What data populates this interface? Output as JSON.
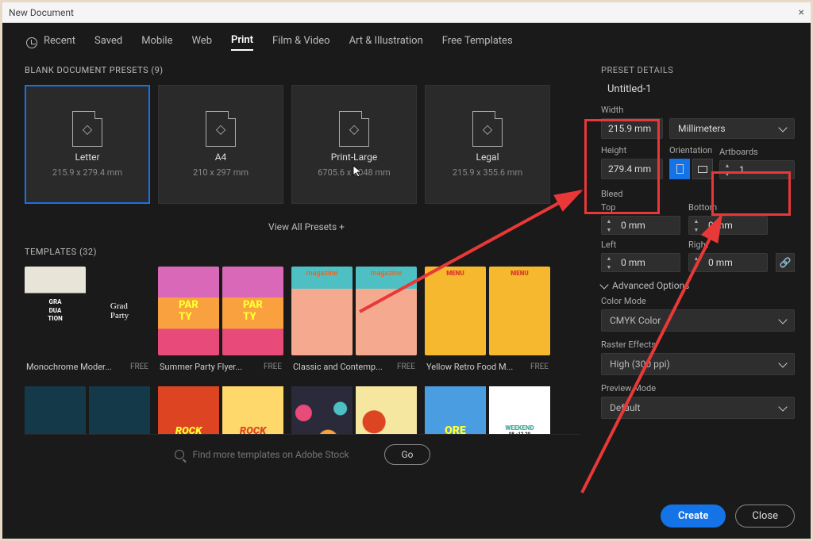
{
  "window": {
    "title": "New Document"
  },
  "tabs": {
    "recent": "Recent",
    "saved": "Saved",
    "mobile": "Mobile",
    "web": "Web",
    "print": "Print",
    "film": "Film & Video",
    "art": "Art & Illustration",
    "free": "Free Templates"
  },
  "presets": {
    "header": "BLANK DOCUMENT PRESETS  (9)",
    "items": [
      {
        "name": "Letter",
        "dim": "215.9 x 279.4 mm"
      },
      {
        "name": "A4",
        "dim": "210 x 297 mm"
      },
      {
        "name": "Print-Large",
        "dim": "6705.6 x 3048 mm"
      },
      {
        "name": "Legal",
        "dim": "215.9 x 355.6 mm"
      }
    ],
    "view_all": "View All Presets +"
  },
  "templates": {
    "header": "TEMPLATES  (32)",
    "items": [
      {
        "name": "Monochrome Moder...",
        "tag": "FREE"
      },
      {
        "name": "Summer Party Flyer...",
        "tag": "FREE"
      },
      {
        "name": "Classic and Contemp...",
        "tag": "FREE"
      },
      {
        "name": "Yellow Retro Food M...",
        "tag": "FREE"
      }
    ]
  },
  "search": {
    "placeholder": "Find more templates on Adobe Stock",
    "go": "Go"
  },
  "details": {
    "header": "PRESET DETAILS",
    "docname": "Untitled-1",
    "width_label": "Width",
    "width_value": "215.9 mm",
    "units": "Millimeters",
    "height_label": "Height",
    "height_value": "279.4 mm",
    "orientation_label": "Orientation",
    "artboards_label": "Artboards",
    "artboards_value": "1",
    "bleed_label": "Bleed",
    "top": "Top",
    "bottom": "Bottom",
    "left": "Left",
    "right": "Right",
    "zero": "0 mm",
    "advanced": "Advanced Options",
    "color_mode_label": "Color Mode",
    "color_mode": "CMYK Color",
    "raster_label": "Raster Effects",
    "raster": "High (300 ppi)",
    "preview_label": "Preview Mode",
    "preview": "Default"
  },
  "actions": {
    "create": "Create",
    "close": "Close"
  }
}
